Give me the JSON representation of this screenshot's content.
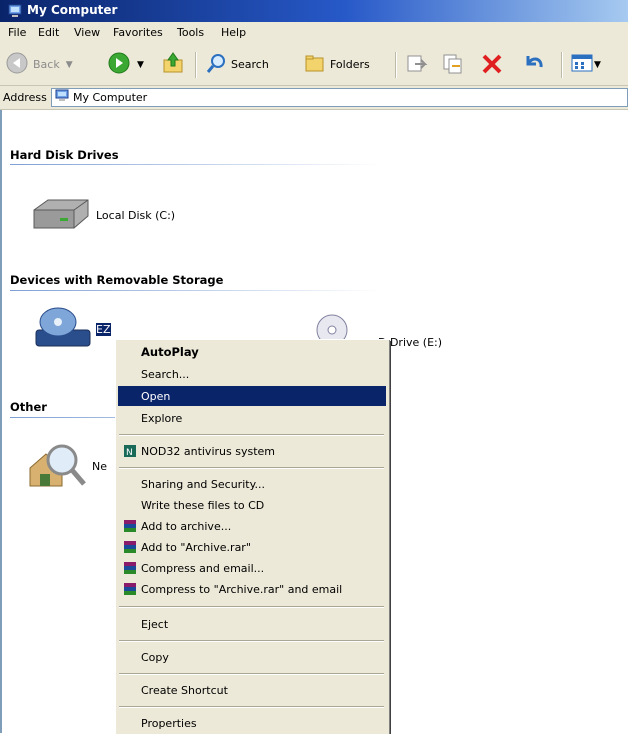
{
  "window": {
    "title": "My Computer"
  },
  "menu": [
    "File",
    "Edit",
    "View",
    "Favorites",
    "Tools",
    "Help"
  ],
  "toolbar": {
    "back_label": "Back",
    "search_label": "Search",
    "folders_label": "Folders"
  },
  "address": {
    "label": "Address",
    "value": "My Computer"
  },
  "sections": {
    "hard_disk": "Hard Disk Drives",
    "removable": "Devices with Removable Storage",
    "other": "Other"
  },
  "drives": {
    "local_disk": "Local Disk (C:)",
    "removable_drive": "EZ",
    "dvd_drive": "D Drive (E:)",
    "other_item": "Ne"
  },
  "context_menu": {
    "items": [
      "AutoPlay",
      "Search...",
      "Open",
      "Explore",
      "NOD32 antivirus system",
      "Sharing and Security...",
      "Write these files to CD",
      "Add to archive...",
      "Add to \"Archive.rar\"",
      "Compress and email...",
      "Compress to \"Archive.rar\" and email",
      "Eject",
      "Copy",
      "Create Shortcut",
      "Properties"
    ],
    "highlighted": "Open",
    "default": "AutoPlay"
  },
  "colors": {
    "title_blue": "#0a246a",
    "menu_bg": "#ece9d8",
    "highlight": "#0a246a",
    "delete_red": "#e02020"
  },
  "icons": [
    "my-computer-icon",
    "back-icon",
    "forward-icon",
    "up-folder-icon",
    "search-icon",
    "folders-icon",
    "move-to-icon",
    "copy-to-icon",
    "delete-icon",
    "undo-icon",
    "views-icon",
    "hard-disk-icon",
    "removable-drive-icon",
    "dvd-drive-icon",
    "network-search-icon",
    "nod32-icon",
    "winrar-icon"
  ]
}
